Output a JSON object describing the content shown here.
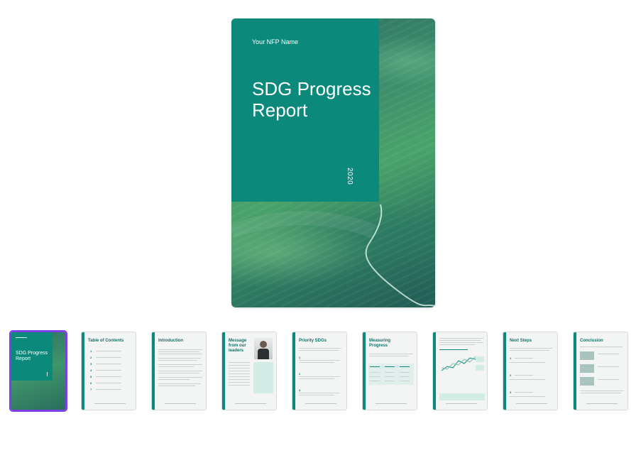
{
  "cover": {
    "org_name": "Your NFP Name",
    "title": "SDG Progress Report",
    "year": "2020"
  },
  "thumbnails": [
    {
      "title": "SDG Progress Report",
      "selected": true
    },
    {
      "title": "Table of Contents",
      "selected": false
    },
    {
      "title": "Introduction",
      "selected": false
    },
    {
      "title": "Message from our leaders",
      "selected": false
    },
    {
      "title": "Priority SDGs",
      "selected": false
    },
    {
      "title": "Measuring Progress",
      "selected": false
    },
    {
      "title": "",
      "selected": false
    },
    {
      "title": "Next Steps",
      "selected": false
    },
    {
      "title": "Conclusion",
      "selected": false
    }
  ],
  "colors": {
    "panel_teal": "#0b8a7c",
    "selection": "#7b3fe4",
    "thumb_bg": "#f3f5f4"
  }
}
